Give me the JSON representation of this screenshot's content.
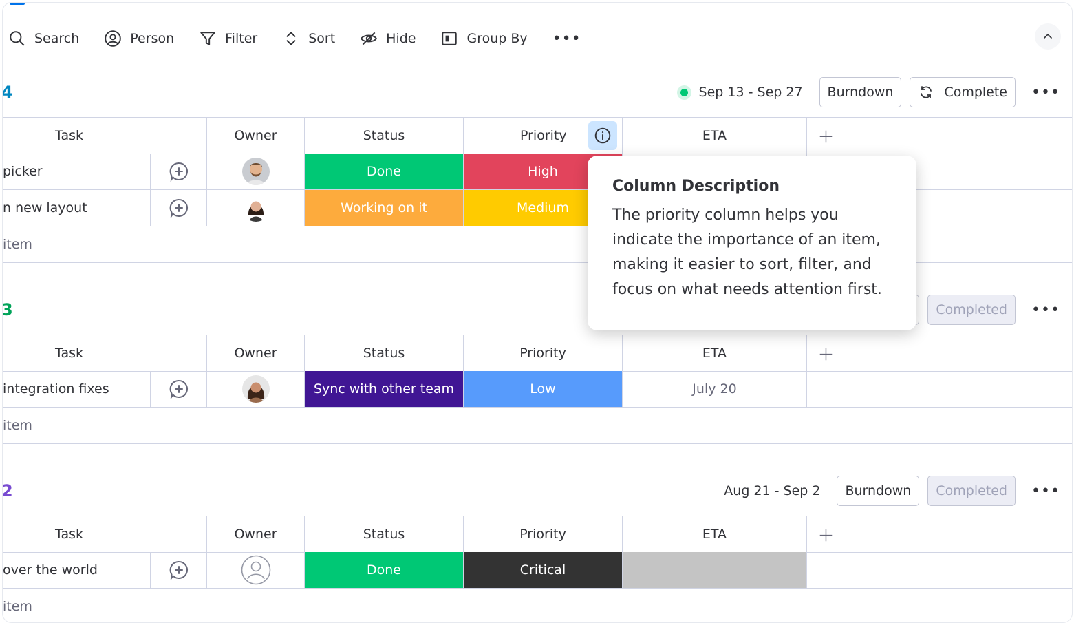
{
  "toolbar": {
    "items": [
      {
        "label": "Search",
        "icon": "search-icon"
      },
      {
        "label": "Person",
        "icon": "person-icon"
      },
      {
        "label": "Filter",
        "icon": "filter-icon"
      },
      {
        "label": "Sort",
        "icon": "sort-icon"
      },
      {
        "label": "Hide",
        "icon": "eye-slash-icon"
      },
      {
        "label": "Group By",
        "icon": "group-by-icon"
      }
    ],
    "more": "•••"
  },
  "columns": {
    "task": "Task",
    "owner": "Owner",
    "status": "Status",
    "priority": "Priority",
    "eta": "ETA",
    "add": "+"
  },
  "add_item_label": "item",
  "groups": [
    {
      "number": "4",
      "color": "#0086c0",
      "date_range": "Sep 13 - Sep 27",
      "status_dot": true,
      "burndown_label": "Burndown",
      "complete_label": "Complete",
      "complete_state": "active",
      "more": "•••",
      "rows": [
        {
          "task": "picker",
          "owner": "avatar-man",
          "status": "Done",
          "status_color": "#00c875",
          "priority": "High",
          "priority_color": "#e2445c",
          "eta": ""
        },
        {
          "task": "n new layout",
          "owner": "avatar-woman",
          "status": "Working on it",
          "status_color": "#fdab3d",
          "priority": "Medium",
          "priority_color": "#ffcb00",
          "eta": ""
        }
      ]
    },
    {
      "number": "3",
      "color": "#00a359",
      "date_range": "",
      "status_dot": false,
      "burndown_label": "",
      "complete_label": "Completed",
      "complete_state": "disabled",
      "more": "•••",
      "rows": [
        {
          "task": "integration fixes",
          "owner": "avatar-woman-2",
          "status": "Sync with other team",
          "status_color": "#401694",
          "priority": "Low",
          "priority_color": "#579bfc",
          "eta": "July 20"
        }
      ]
    },
    {
      "number": "2",
      "color": "#784bd1",
      "date_range": "Aug 21 - Sep 2",
      "status_dot": false,
      "burndown_label": "Burndown",
      "complete_label": "Completed",
      "complete_state": "disabled",
      "more": "•••",
      "rows": [
        {
          "task": "over the world",
          "owner": "avatar-empty",
          "status": "Done",
          "status_color": "#00c875",
          "priority": "Critical",
          "priority_color": "#333333",
          "eta": ""
        }
      ]
    }
  ],
  "tooltip": {
    "title": "Column Description",
    "body": "The priority column helps you indicate the importance of an item, making it easier to sort, filter, and focus on what needs attention first."
  }
}
